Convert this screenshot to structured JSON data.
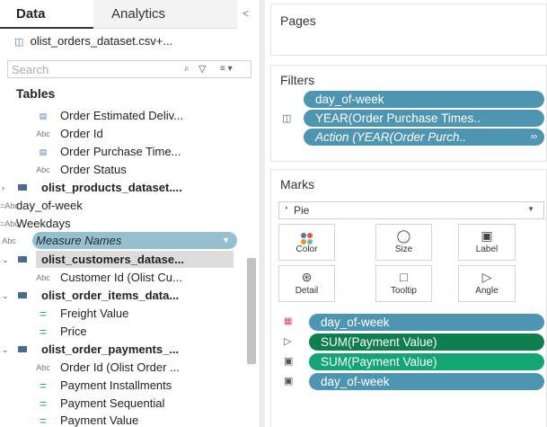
{
  "tabs": {
    "data": "Data",
    "analytics": "Analytics",
    "collapse": "<"
  },
  "datasource": {
    "name": "olist_orders_dataset.csv+..."
  },
  "search": {
    "placeholder": "Search",
    "search_icon": "⌕",
    "filter_icon": "▽",
    "view_icon": "≡ ▾"
  },
  "tables_header": "Tables",
  "fields": [
    {
      "label": "Order Estimated Deliv...",
      "icon": "calendar-icon",
      "glyph": "▤"
    },
    {
      "label": "Order Id",
      "icon": "string-icon",
      "glyph": "Abc"
    },
    {
      "label": "Order Purchase Time...",
      "icon": "calendar-icon",
      "glyph": "▤"
    },
    {
      "label": "Order Status",
      "icon": "string-icon",
      "glyph": "Abc"
    },
    {
      "label": "olist_products_dataset....",
      "icon": "table-icon",
      "glyph": ""
    },
    {
      "label": "day_of-week",
      "icon": "string-icon",
      "glyph": "=Abc"
    },
    {
      "label": "Weekdays",
      "icon": "string-icon",
      "glyph": "=Abc"
    },
    {
      "label": "Measure Names",
      "icon": "string-icon",
      "glyph": "Abc"
    },
    {
      "label": "olist_customers_datase...",
      "icon": "table-icon",
      "glyph": ""
    },
    {
      "label": "Customer Id (Olist Cu...",
      "icon": "string-icon",
      "glyph": "Abc"
    },
    {
      "label": "olist_order_items_data...",
      "icon": "table-icon",
      "glyph": ""
    },
    {
      "label": "Freight Value",
      "icon": "measure-icon",
      "glyph": "="
    },
    {
      "label": "Price",
      "icon": "measure-icon",
      "glyph": "="
    },
    {
      "label": "olist_order_payments_...",
      "icon": "table-icon",
      "glyph": ""
    },
    {
      "label": "Order Id (Olist Order ...",
      "icon": "string-icon",
      "glyph": "Abc"
    },
    {
      "label": "Payment Installments",
      "icon": "measure-icon",
      "glyph": "="
    },
    {
      "label": "Payment Sequential",
      "icon": "measure-icon",
      "glyph": "="
    },
    {
      "label": "Payment Value",
      "icon": "measure-icon",
      "glyph": "="
    }
  ],
  "pages": {
    "title": "Pages"
  },
  "filters": {
    "title": "Filters",
    "pills": [
      "day_of-week",
      "YEAR(Order Purchase Times..",
      "Action (YEAR(Order Purch.."
    ]
  },
  "marks": {
    "title": "Marks",
    "type": "Pie",
    "buttons": [
      "Color",
      "Size",
      "Label",
      "Detail",
      "Tooltip",
      "Angle"
    ],
    "pills": [
      "day_of-week",
      "SUM(Payment Value)",
      "SUM(Payment Value)",
      "day_of-week"
    ]
  },
  "colors": {
    "blue_pill": "#4e95b2",
    "green_pill": "#14a574",
    "dark_green_pill": "#0f7f50"
  }
}
